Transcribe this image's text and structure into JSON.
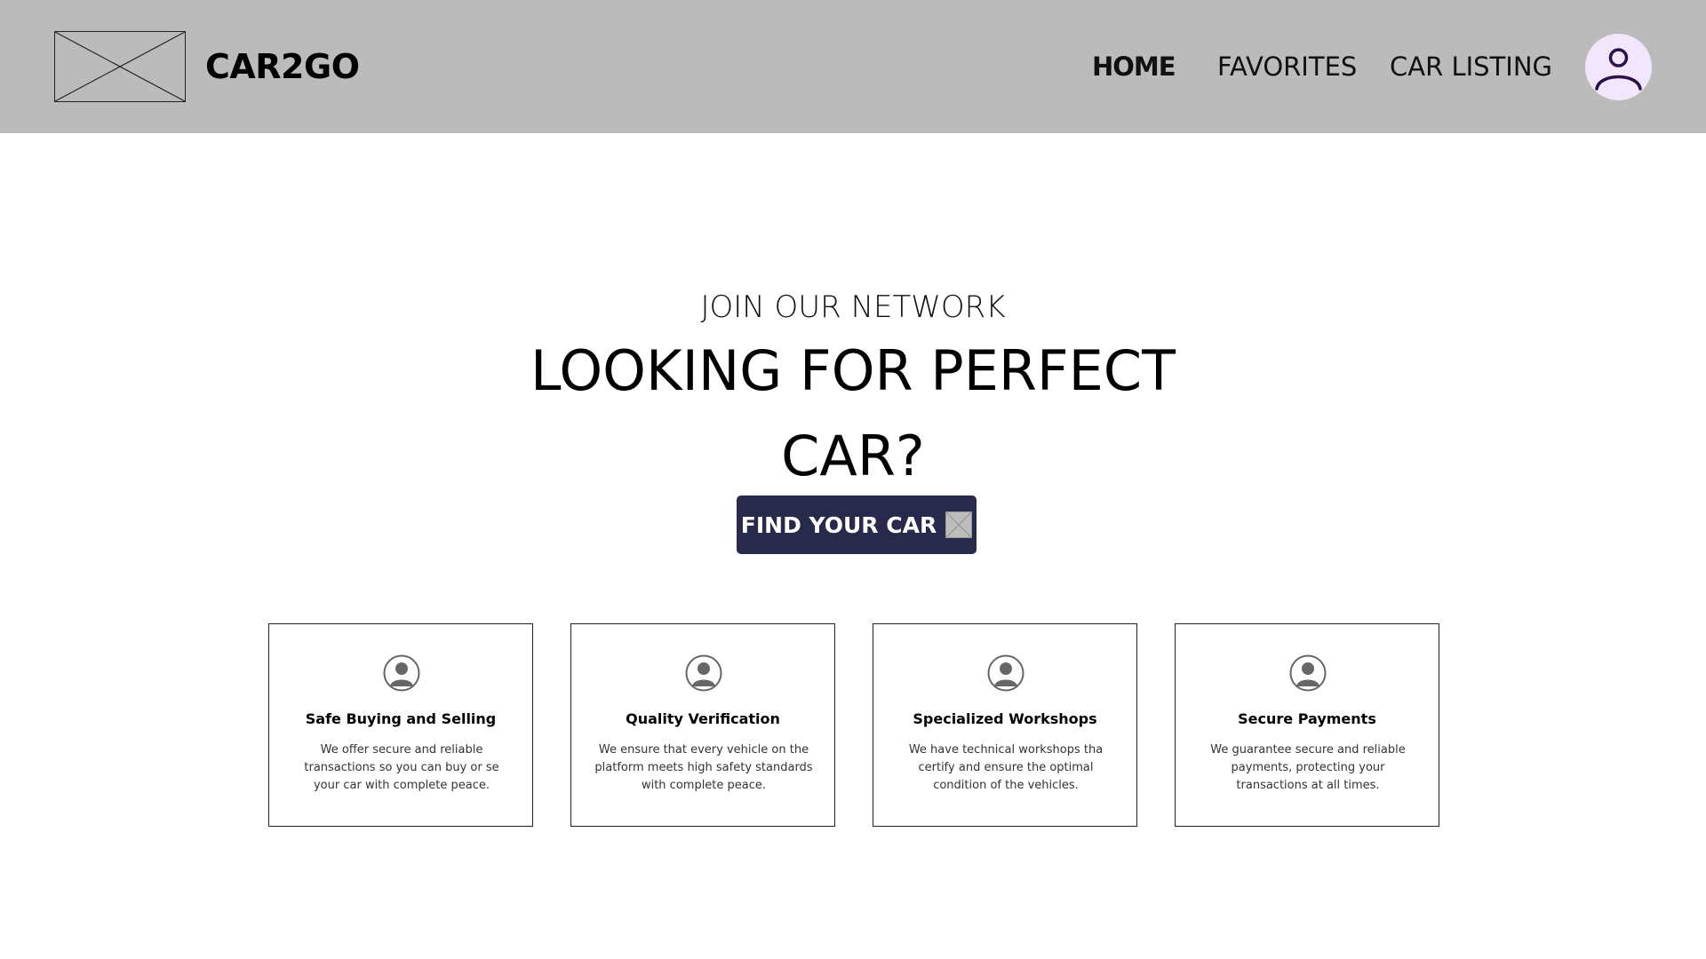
{
  "header": {
    "brand": "CAR2GO",
    "nav": [
      {
        "label": "HOME",
        "active": true
      },
      {
        "label": "FAVORITES",
        "active": false
      },
      {
        "label": "CAR LISTING",
        "active": false
      }
    ],
    "logo_icon": "image-placeholder-icon",
    "avatar_icon": "user-icon"
  },
  "hero": {
    "kicker": "JOIN OUR NETWORK",
    "title": "LOOKING FOR PERFECT CAR?",
    "cta_label": "FIND YOUR CAR",
    "cta_icon": "image-placeholder-icon"
  },
  "features": [
    {
      "icon": "person-icon",
      "title": "Safe Buying and Selling",
      "text": "We offer secure and reliable transactions so you can buy or se your car with complete peace."
    },
    {
      "icon": "person-icon",
      "title": "Quality Verification",
      "text": "We ensure that every vehicle on the platform meets high safety standards with complete peace."
    },
    {
      "icon": "person-icon",
      "title": "Specialized Workshops",
      "text": "We have technical workshops tha certify and ensure the optimal condition of the vehicles."
    },
    {
      "icon": "person-icon",
      "title": "Secure Payments",
      "text": "We guarantee secure and reliable payments, protecting your transactions at all times."
    }
  ],
  "colors": {
    "header_bg": "#bbbbbb",
    "cta_bg": "#272a4a",
    "avatar_bg": "#f1e6fb",
    "avatar_stroke": "#2a0f4a"
  }
}
